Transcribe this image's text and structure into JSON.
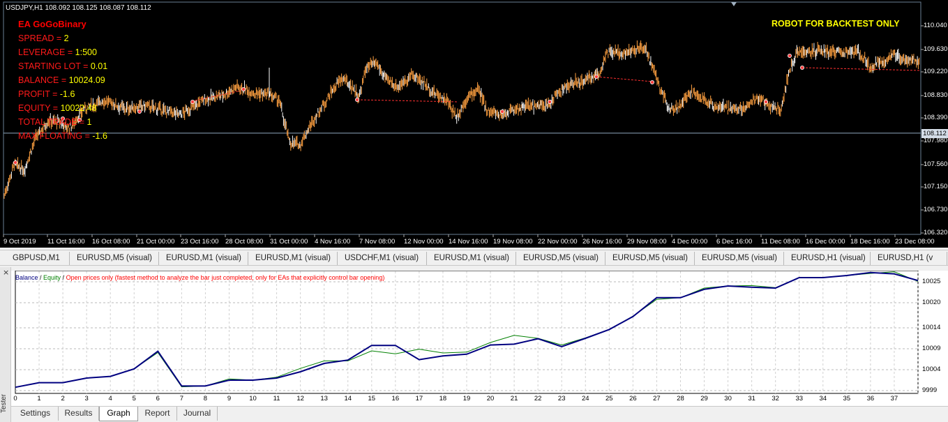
{
  "chart": {
    "symbol_line": "USDJPY,H1  108.092 108.125 108.087 108.112",
    "ea": {
      "title": "EA GoGoBinary",
      "lines": [
        {
          "label": "SPREAD = ",
          "value": "2"
        },
        {
          "label": "LEVERAGE = ",
          "value": "1:500"
        },
        {
          "label": "STARTING LOT = ",
          "value": "0.01"
        },
        {
          "label": "BALANCE = ",
          "value": "10024.09"
        },
        {
          "label": "PROFIT = ",
          "value": "-1.6"
        },
        {
          "label": "EQUITY = ",
          "value": "10022.48"
        },
        {
          "label": "TOTAL TRADE = ",
          "value": "1"
        },
        {
          "label": "MAX FLOATING = ",
          "value": "-1.6"
        }
      ]
    },
    "robot_note": "ROBOT FOR BACKTEST ONLY",
    "price_axis": [
      "110.040",
      "109.630",
      "109.220",
      "108.830",
      "108.390",
      "107.980",
      "107.560",
      "107.150",
      "106.730",
      "106.320"
    ],
    "current_price": "108.112",
    "time_axis": [
      "9 Oct 2019",
      "11 Oct 16:00",
      "16 Oct 08:00",
      "21 Oct 00:00",
      "23 Oct 16:00",
      "28 Oct 08:00",
      "31 Oct 00:00",
      "4 Nov 16:00",
      "7 Nov 08:00",
      "12 Nov 00:00",
      "14 Nov 16:00",
      "19 Nov 08:00",
      "22 Nov 00:00",
      "26 Nov 16:00",
      "29 Nov 08:00",
      "4 Dec 00:00",
      "6 Dec 16:00",
      "11 Dec 08:00",
      "16 Dec 00:00",
      "18 Dec 16:00",
      "23 Dec 08:00"
    ],
    "colors": {
      "background": "#000000",
      "candle": "#ffa040",
      "grid": "#2e4f6b",
      "current_line": "#8fa8c0",
      "trade_marker": "#ff4040",
      "trade_line": "#ff3030"
    }
  },
  "chart_tabs": [
    "GBPUSD,M1",
    "EURUSD,M5 (visual)",
    "EURUSD,M1 (visual)",
    "EURUSD,M1 (visual)",
    "USDCHF,M1 (visual)",
    "EURUSD,M1 (visual)",
    "EURUSD,M5 (visual)",
    "EURUSD,M5 (visual)",
    "EURUSD,M5 (visual)",
    "EURUSD,H1 (visual)",
    "EURUSD,H1 (v"
  ],
  "tester": {
    "side_label": "Tester",
    "close_icon": "×",
    "legend": {
      "balance": "Balance",
      "sep1": " / ",
      "equity": "Equity",
      "sep2": " / ",
      "mode": "Open prices only (fastest method to analyze the bar just completed, only for EAs that explicitly control bar opening)"
    },
    "tabs": [
      {
        "label": "Settings",
        "active": false
      },
      {
        "label": "Results",
        "active": false
      },
      {
        "label": "Graph",
        "active": true
      },
      {
        "label": "Report",
        "active": false
      },
      {
        "label": "Journal",
        "active": false
      }
    ]
  },
  "chart_data": {
    "type": "line",
    "x": [
      0,
      1,
      2,
      3,
      4,
      5,
      6,
      7,
      8,
      9,
      10,
      11,
      12,
      13,
      14,
      15,
      16,
      17,
      18,
      19,
      20,
      21,
      22,
      23,
      24,
      25,
      26,
      27,
      28,
      29,
      30,
      31,
      32,
      33,
      34,
      35,
      36,
      37,
      38
    ],
    "y_ticks": [
      10025,
      10020,
      10014,
      10009,
      10004,
      9999
    ],
    "ylim": [
      9999,
      10026
    ],
    "series": [
      {
        "name": "Balance",
        "color": "#000080",
        "values": [
          9999.8,
          10000.9,
          10000.9,
          10002.0,
          10002.4,
          10004.2,
          10008.4,
          10000.1,
          10000.1,
          10001.5,
          10001.5,
          10002.0,
          10003.5,
          10005.5,
          10006.3,
          10009.8,
          10009.8,
          10006.4,
          10007.3,
          10007.7,
          10009.9,
          10010.1,
          10011.4,
          10009.5,
          10011.5,
          10013.6,
          10016.7,
          10021.2,
          10021.2,
          10023.2,
          10024.0,
          10023.7,
          10023.5,
          10026.0,
          10026.0,
          10026.5,
          10027.2,
          10026.9,
          10025.3
        ]
      },
      {
        "name": "Equity",
        "color": "#008000",
        "values": [
          9999.8,
          10000.9,
          10000.9,
          10002.0,
          10002.4,
          10004.2,
          10008.1,
          9999.9,
          10000.1,
          10001.8,
          10001.5,
          10002.2,
          10004.3,
          10006.1,
          10006.1,
          10008.5,
          10007.8,
          10008.9,
          10008.0,
          10008.2,
          10010.5,
          10012.2,
          10011.5,
          10009.9,
          10011.6,
          10013.6,
          10016.8,
          10020.8,
          10021.2,
          10023.5,
          10024.0,
          10024.1,
          10023.6,
          10026.0,
          10026.0,
          10026.5,
          10027.0,
          10027.4,
          10025.1
        ]
      }
    ]
  }
}
